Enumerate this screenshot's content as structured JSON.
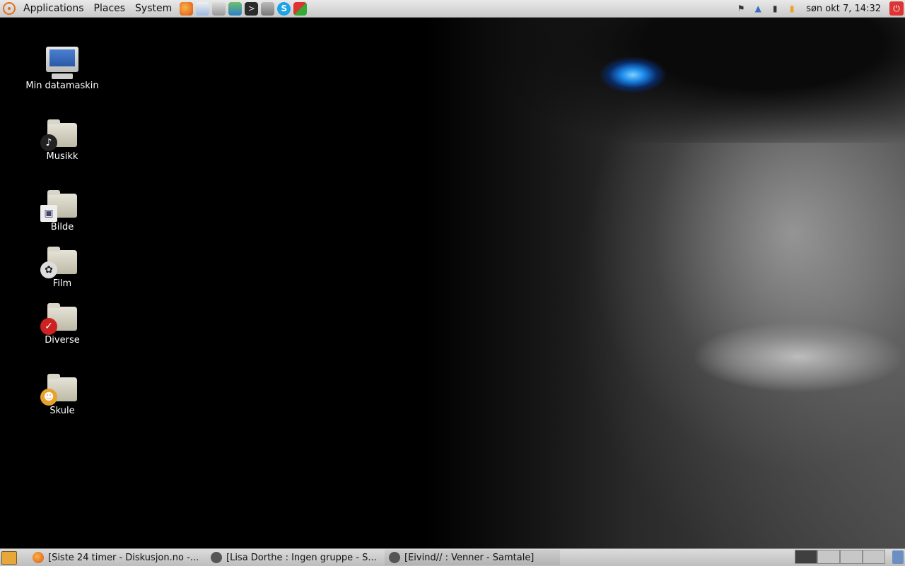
{
  "top_panel": {
    "menus": [
      "Applications",
      "Places",
      "System"
    ],
    "launchers": [
      "firefox-icon",
      "mail-icon",
      "files-icon",
      "messenger-icon",
      "terminal-icon",
      "calculator-icon",
      "skype-icon",
      "jigsaw-icon"
    ],
    "tray_icons": [
      "network-icon",
      "wifi-icon",
      "signal-icon",
      "battery-icon"
    ],
    "clock": "søn okt  7, 14:32"
  },
  "desktop": {
    "icons": [
      {
        "label": "Min datamaskin",
        "icon": "computer-icon"
      },
      {
        "label": "Musikk",
        "icon": "music-folder-icon"
      },
      {
        "label": "Bilde",
        "icon": "pictures-folder-icon"
      },
      {
        "label": "Film",
        "icon": "video-folder-icon"
      },
      {
        "label": "Diverse",
        "icon": "misc-folder-icon"
      },
      {
        "label": "Skule",
        "icon": "school-folder-icon"
      }
    ]
  },
  "bottom_panel": {
    "tasks": [
      {
        "label": "[Siste 24 timer - Diskusjon.no -...",
        "icon": "firefox-icon"
      },
      {
        "label": "[Lisa Dorthe : Ingen gruppe - S...",
        "icon": "chat-icon"
      },
      {
        "label": "[Eivind// : Venner - Samtale]",
        "icon": "chat-icon"
      }
    ],
    "workspaces": 4,
    "active_workspace": 1
  },
  "colors": {
    "panel": "#d3d3d3",
    "eye_blue": "#1a86e6"
  }
}
